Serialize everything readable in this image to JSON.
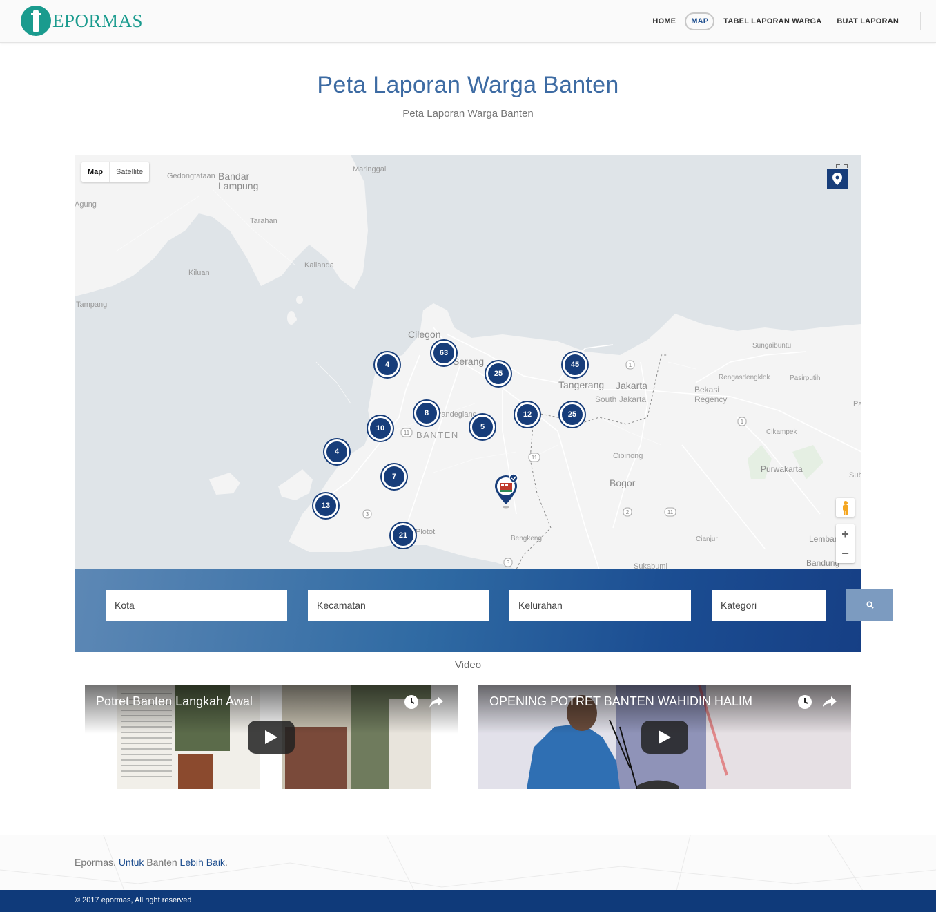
{
  "brand": {
    "name": "EPORMAS"
  },
  "nav": {
    "items": [
      "HOME",
      "MAP",
      "TABEL LAPORAN WARGA",
      "BUAT LAPORAN"
    ],
    "active": "MAP"
  },
  "page": {
    "title": "Peta Laporan Warga Banten",
    "subtitle": "Peta Laporan Warga Banten"
  },
  "map": {
    "type_buttons": [
      "Map",
      "Satellite"
    ],
    "selected_type": "Map",
    "labels": [
      "Gedongtataan",
      "Bandar Lampung",
      "Maringgai",
      "Agung",
      "Tarahan",
      "Kalianda",
      "Kiluan",
      "Tampang",
      "Cilegon",
      "Serang",
      "Tangerang",
      "Jakarta",
      "South Jakarta",
      "Bekasi Regency",
      "Sungaibuntu",
      "Rengasdengklok",
      "Pasirputih",
      "Pandeglang",
      "BANTEN",
      "Cibinong",
      "Bogor",
      "Cikampek",
      "Purwakarta",
      "Sukabumi",
      "Bandung",
      "Lembang",
      "Plotot",
      "Bengkeng",
      "Cianjur",
      "Subang",
      "Pa"
    ],
    "clusters": [
      {
        "count": "63"
      },
      {
        "count": "4"
      },
      {
        "count": "25"
      },
      {
        "count": "45"
      },
      {
        "count": "8"
      },
      {
        "count": "10"
      },
      {
        "count": "5"
      },
      {
        "count": "12"
      },
      {
        "count": "25"
      },
      {
        "count": "4"
      },
      {
        "count": "7"
      },
      {
        "count": "13"
      },
      {
        "count": "21"
      }
    ],
    "route_shields": [
      "1",
      "11",
      "11",
      "1",
      "3",
      "2",
      "11",
      "3"
    ],
    "zoom_in": "+",
    "zoom_out": "−",
    "accent": "#173d7a"
  },
  "filters": {
    "kota": "Kota",
    "kecamatan": "Kecamatan",
    "kelurahan": "Kelurahan",
    "kategori": "Kategori"
  },
  "video": {
    "heading": "Video",
    "items": [
      {
        "title": "Potret Banten Langkah Awal"
      },
      {
        "title": "OPENING POTRET BANTEN WAHIDIN HALIM"
      }
    ]
  },
  "footer": {
    "tagline_parts": [
      "Epormas. ",
      "Untuk",
      " Banten ",
      "Lebih Baik",
      "."
    ],
    "copyright": "© 2017 epormas, All right reserved"
  }
}
